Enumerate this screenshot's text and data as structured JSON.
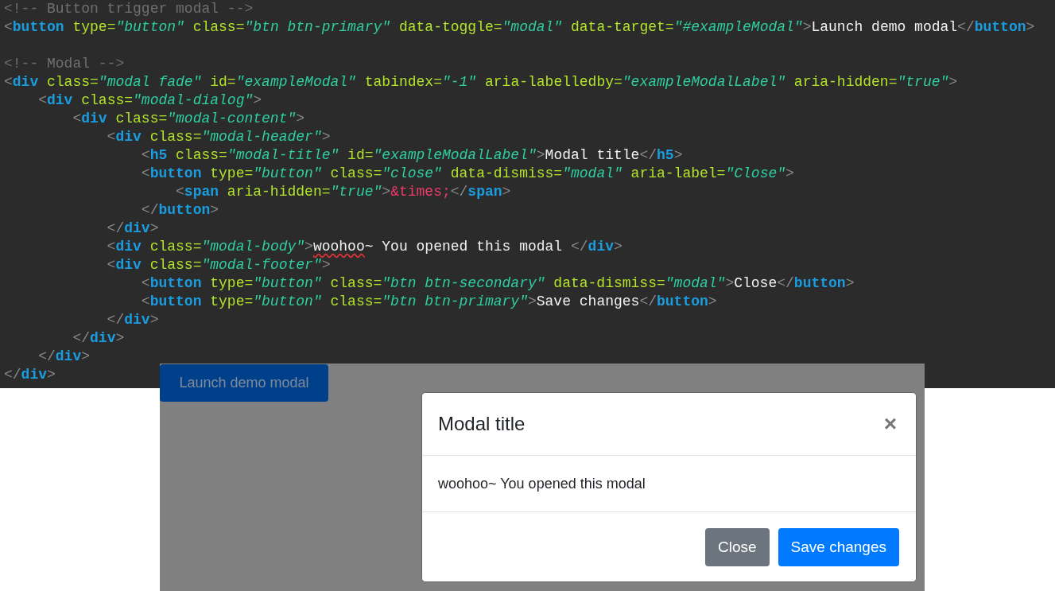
{
  "code_editor": {
    "lines": [
      {
        "kind": "code",
        "tokens": [
          {
            "kind": "comment",
            "text": "<!-- Button trigger modal -->"
          }
        ]
      },
      {
        "kind": "code",
        "tokens": [
          {
            "kind": "punct",
            "text": "<"
          },
          {
            "kind": "tag",
            "text": "button"
          },
          {
            "kind": "attr",
            "text": " type="
          },
          {
            "kind": "string",
            "text": "\"button\""
          },
          {
            "kind": "attr",
            "text": " class="
          },
          {
            "kind": "string",
            "text": "\"btn btn-primary\""
          },
          {
            "kind": "attr",
            "text": " data-toggle="
          },
          {
            "kind": "string",
            "text": "\"modal\""
          },
          {
            "kind": "attr",
            "text": " data-target="
          },
          {
            "kind": "string",
            "text": "\"#exampleModal\""
          },
          {
            "kind": "punct",
            "text": ">"
          },
          {
            "kind": "text",
            "text": "Launch demo modal"
          },
          {
            "kind": "punct",
            "text": "</"
          },
          {
            "kind": "tag",
            "text": "button"
          },
          {
            "kind": "punct",
            "text": ">"
          }
        ]
      },
      {
        "kind": "blank"
      },
      {
        "kind": "code",
        "tokens": [
          {
            "kind": "comment",
            "text": "<!-- Modal -->"
          }
        ]
      },
      {
        "kind": "code",
        "tokens": [
          {
            "kind": "punct",
            "text": "<"
          },
          {
            "kind": "tag",
            "text": "div"
          },
          {
            "kind": "attr",
            "text": " class="
          },
          {
            "kind": "string",
            "text": "\"modal fade\""
          },
          {
            "kind": "attr",
            "text": " id="
          },
          {
            "kind": "string",
            "text": "\"exampleModal\""
          },
          {
            "kind": "attr",
            "text": " tabindex="
          },
          {
            "kind": "string",
            "text": "\"-1\""
          },
          {
            "kind": "attr",
            "text": " aria-labelledby="
          },
          {
            "kind": "string",
            "text": "\"exampleModalLabel\""
          },
          {
            "kind": "attr",
            "text": " aria-hidden="
          },
          {
            "kind": "string",
            "text": "\"true\""
          },
          {
            "kind": "punct",
            "text": ">"
          }
        ]
      },
      {
        "kind": "code",
        "tokens": [
          {
            "kind": "punct",
            "text": "    <"
          },
          {
            "kind": "tag",
            "text": "div"
          },
          {
            "kind": "attr",
            "text": " class="
          },
          {
            "kind": "string",
            "text": "\"modal-dialog\""
          },
          {
            "kind": "punct",
            "text": ">"
          }
        ]
      },
      {
        "kind": "code",
        "tokens": [
          {
            "kind": "punct",
            "text": "        <"
          },
          {
            "kind": "tag",
            "text": "div"
          },
          {
            "kind": "attr",
            "text": " class="
          },
          {
            "kind": "string",
            "text": "\"modal-content\""
          },
          {
            "kind": "punct",
            "text": ">"
          }
        ]
      },
      {
        "kind": "code",
        "tokens": [
          {
            "kind": "punct",
            "text": "            <"
          },
          {
            "kind": "tag",
            "text": "div"
          },
          {
            "kind": "attr",
            "text": " class="
          },
          {
            "kind": "string",
            "text": "\"modal-header\""
          },
          {
            "kind": "punct",
            "text": ">"
          }
        ]
      },
      {
        "kind": "code",
        "tokens": [
          {
            "kind": "punct",
            "text": "                <"
          },
          {
            "kind": "tag",
            "text": "h5"
          },
          {
            "kind": "attr",
            "text": " class="
          },
          {
            "kind": "string",
            "text": "\"modal-title\""
          },
          {
            "kind": "attr",
            "text": " id="
          },
          {
            "kind": "string",
            "text": "\"exampleModalLabel\""
          },
          {
            "kind": "punct",
            "text": ">"
          },
          {
            "kind": "text",
            "text": "Modal title"
          },
          {
            "kind": "punct",
            "text": "</"
          },
          {
            "kind": "tag",
            "text": "h5"
          },
          {
            "kind": "punct",
            "text": ">"
          }
        ]
      },
      {
        "kind": "code",
        "tokens": [
          {
            "kind": "punct",
            "text": "                <"
          },
          {
            "kind": "tag",
            "text": "button"
          },
          {
            "kind": "attr",
            "text": " type="
          },
          {
            "kind": "string",
            "text": "\"button\""
          },
          {
            "kind": "attr",
            "text": " class="
          },
          {
            "kind": "string",
            "text": "\"close\""
          },
          {
            "kind": "attr",
            "text": " data-dismiss="
          },
          {
            "kind": "string",
            "text": "\"modal\""
          },
          {
            "kind": "attr",
            "text": " aria-label="
          },
          {
            "kind": "string",
            "text": "\"Close\""
          },
          {
            "kind": "punct",
            "text": ">"
          }
        ]
      },
      {
        "kind": "code",
        "tokens": [
          {
            "kind": "punct",
            "text": "                    <"
          },
          {
            "kind": "tag",
            "text": "span"
          },
          {
            "kind": "attr",
            "text": " aria-hidden="
          },
          {
            "kind": "string",
            "text": "\"true\""
          },
          {
            "kind": "punct",
            "text": ">"
          },
          {
            "kind": "entity",
            "text": "&times;"
          },
          {
            "kind": "punct",
            "text": "</"
          },
          {
            "kind": "tag",
            "text": "span"
          },
          {
            "kind": "punct",
            "text": ">"
          }
        ]
      },
      {
        "kind": "code",
        "tokens": [
          {
            "kind": "punct",
            "text": "                </"
          },
          {
            "kind": "tag",
            "text": "button"
          },
          {
            "kind": "punct",
            "text": ">"
          }
        ]
      },
      {
        "kind": "code",
        "tokens": [
          {
            "kind": "punct",
            "text": "            </"
          },
          {
            "kind": "tag",
            "text": "div"
          },
          {
            "kind": "punct",
            "text": ">"
          }
        ]
      },
      {
        "kind": "code",
        "tokens": [
          {
            "kind": "punct",
            "text": "            <"
          },
          {
            "kind": "tag",
            "text": "div"
          },
          {
            "kind": "attr",
            "text": " class="
          },
          {
            "kind": "string",
            "text": "\"modal-body\""
          },
          {
            "kind": "punct",
            "text": ">"
          },
          {
            "kind": "misspelled",
            "text": "woohoo"
          },
          {
            "kind": "text",
            "text": "~ You opened this modal "
          },
          {
            "kind": "punct",
            "text": "</"
          },
          {
            "kind": "tag",
            "text": "div"
          },
          {
            "kind": "punct",
            "text": ">"
          }
        ]
      },
      {
        "kind": "code",
        "tokens": [
          {
            "kind": "punct",
            "text": "            <"
          },
          {
            "kind": "tag",
            "text": "div"
          },
          {
            "kind": "attr",
            "text": " class="
          },
          {
            "kind": "string",
            "text": "\"modal-footer\""
          },
          {
            "kind": "punct",
            "text": ">"
          }
        ]
      },
      {
        "kind": "code",
        "tokens": [
          {
            "kind": "punct",
            "text": "                <"
          },
          {
            "kind": "tag",
            "text": "button"
          },
          {
            "kind": "attr",
            "text": " type="
          },
          {
            "kind": "string",
            "text": "\"button\""
          },
          {
            "kind": "attr",
            "text": " class="
          },
          {
            "kind": "string",
            "text": "\"btn btn-secondary\""
          },
          {
            "kind": "attr",
            "text": " data-dismiss="
          },
          {
            "kind": "string",
            "text": "\"modal\""
          },
          {
            "kind": "punct",
            "text": ">"
          },
          {
            "kind": "text",
            "text": "Close"
          },
          {
            "kind": "punct",
            "text": "</"
          },
          {
            "kind": "tag",
            "text": "button"
          },
          {
            "kind": "punct",
            "text": ">"
          }
        ]
      },
      {
        "kind": "code",
        "tokens": [
          {
            "kind": "punct",
            "text": "                <"
          },
          {
            "kind": "tag",
            "text": "button"
          },
          {
            "kind": "attr",
            "text": " type="
          },
          {
            "kind": "string",
            "text": "\"button\""
          },
          {
            "kind": "attr",
            "text": " class="
          },
          {
            "kind": "string",
            "text": "\"btn btn-primary\""
          },
          {
            "kind": "punct",
            "text": ">"
          },
          {
            "kind": "text",
            "text": "Save changes"
          },
          {
            "kind": "punct",
            "text": "</"
          },
          {
            "kind": "tag",
            "text": "button"
          },
          {
            "kind": "punct",
            "text": ">"
          }
        ]
      },
      {
        "kind": "code",
        "tokens": [
          {
            "kind": "punct",
            "text": "            </"
          },
          {
            "kind": "tag",
            "text": "div"
          },
          {
            "kind": "punct",
            "text": ">"
          }
        ]
      },
      {
        "kind": "code",
        "tokens": [
          {
            "kind": "punct",
            "text": "        </"
          },
          {
            "kind": "tag",
            "text": "div"
          },
          {
            "kind": "punct",
            "text": ">"
          }
        ]
      },
      {
        "kind": "code",
        "tokens": [
          {
            "kind": "punct",
            "text": "    </"
          },
          {
            "kind": "tag",
            "text": "div"
          },
          {
            "kind": "punct",
            "text": ">"
          }
        ]
      },
      {
        "kind": "code",
        "tokens": [
          {
            "kind": "punct",
            "text": "</"
          },
          {
            "kind": "tag",
            "text": "div"
          },
          {
            "kind": "punct",
            "text": ">"
          }
        ]
      }
    ]
  },
  "demo": {
    "launch_button": "Launch demo modal",
    "modal": {
      "open": true,
      "title": "Modal title",
      "close_symbol": "×",
      "body": "woohoo~ You opened this modal",
      "buttons": [
        {
          "label": "Close",
          "kind": "secondary"
        },
        {
          "label": "Save changes",
          "kind": "primary"
        }
      ]
    }
  }
}
